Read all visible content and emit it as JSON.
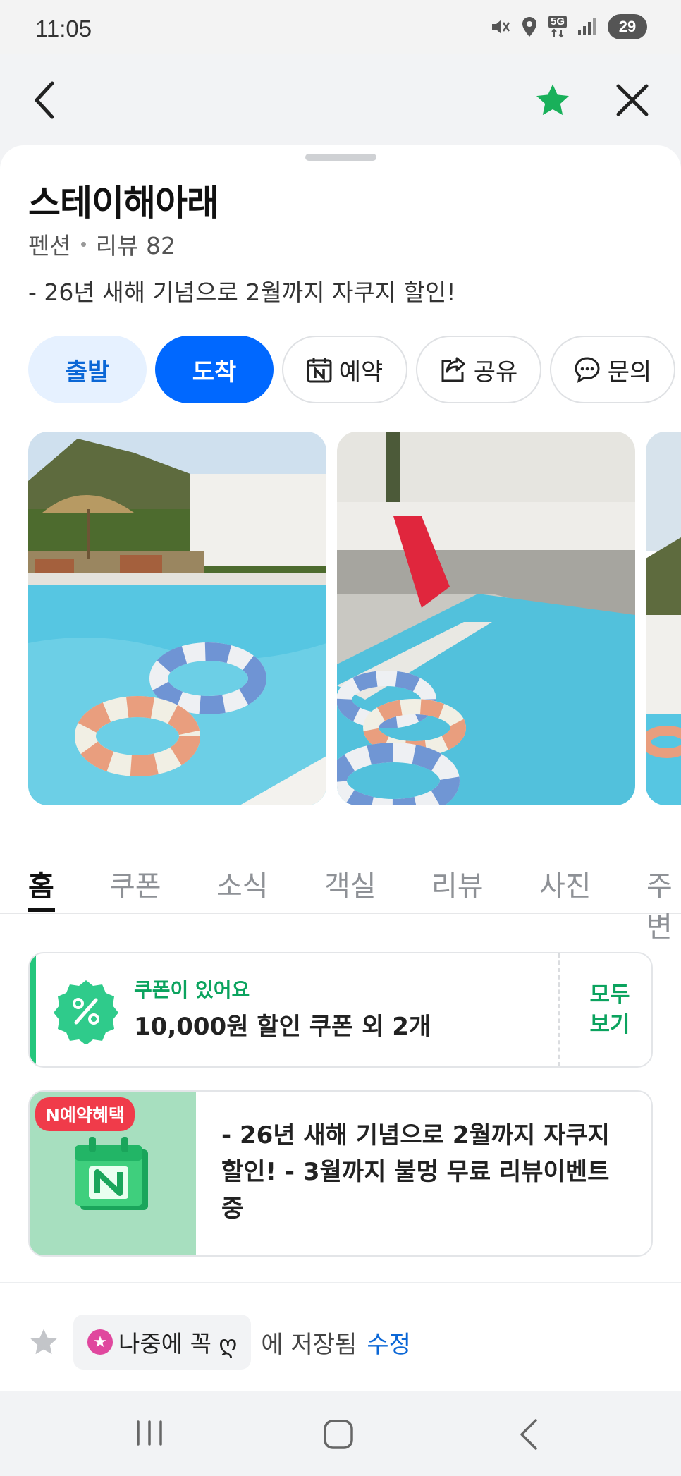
{
  "status_bar": {
    "time": "11:05",
    "battery": "29",
    "network": "5G"
  },
  "nav": {
    "back_icon": "chevron-left-icon",
    "favorite_icon": "star-icon",
    "close_icon": "close-icon",
    "favorite_color": "#19b05a"
  },
  "place": {
    "name": "스테이해아래",
    "category": "펜션",
    "review_label": "리뷰 82",
    "promo": "- 26년 새해 기념으로 2월까지 자쿠지 할인!"
  },
  "actions": {
    "depart": "출발",
    "arrive": "도착",
    "reserve": "예약",
    "share": "공유",
    "inquiry": "문의"
  },
  "tabs": [
    "홈",
    "쿠폰",
    "소식",
    "객실",
    "리뷰",
    "사진",
    "주변"
  ],
  "coupon": {
    "subtitle": "쿠폰이 있어요",
    "title": "10,000원 할인 쿠폰 외 2개",
    "view_all": "모두 보기"
  },
  "benefit": {
    "badge": "N예약혜택",
    "text": "- 26년 새해 기념으로 2월까지 자쿠지 할인! - 3월까지 불멍 무료 리뷰이벤트 중"
  },
  "saved": {
    "list_name": "나중에 꼭 ღ",
    "suffix": "에 저장됨",
    "edit": "수정"
  },
  "colors": {
    "primary": "#0068ff",
    "green": "#0ba35e",
    "badge_red": "#f03b4a"
  }
}
